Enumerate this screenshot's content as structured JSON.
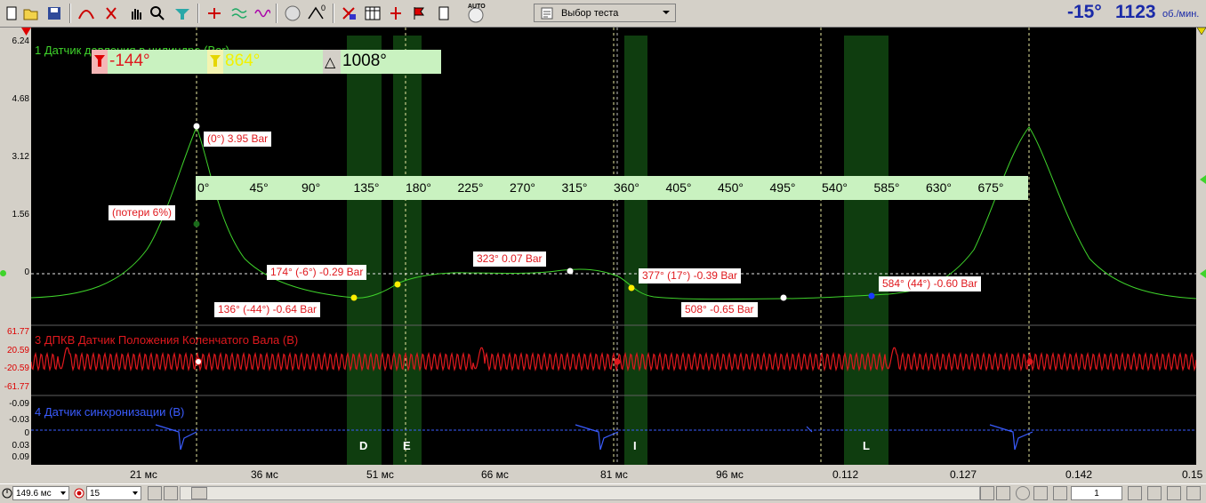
{
  "toolbar": {
    "test_select_label": "Выбор теста",
    "auto_label": "AUTO",
    "counter_small": "0"
  },
  "header": {
    "angle": "-15°",
    "rpm": "1123",
    "rpm_unit": "об./мин."
  },
  "cursor_panel": {
    "cursor1": "-144°",
    "cursor2": "864°",
    "delta_symbol": "△",
    "delta": "1008°"
  },
  "channels": {
    "ch1_title": "1 Датчик давления в цилиндре (Bar)",
    "ch3_title": "3 ДПКВ Датчик Положения Коленчатого Вала (В)",
    "ch4_title": "4 Датчик синхронизации (В)"
  },
  "y_axis": {
    "ch1_ticks": [
      "6.24",
      "4.68",
      "3.12",
      "1.56",
      "0"
    ],
    "ch3_ticks": [
      "61.77",
      "20.59",
      "-20.59",
      "-61.77"
    ],
    "ch4_ticks": [
      "-0.09",
      "-0.03",
      "0",
      "0.03",
      "0.09"
    ]
  },
  "angle_strip": {
    "ticks": [
      "0°",
      "45°",
      "90°",
      "135°",
      "180°",
      "225°",
      "270°",
      "315°",
      "360°",
      "405°",
      "450°",
      "495°",
      "540°",
      "585°",
      "630°",
      "675°"
    ]
  },
  "annotations": {
    "peak": "(0°) 3.95 Bar",
    "losses": "(потери 6%)",
    "a136": "136° (-44°) -0.64 Bar",
    "a174": "174° (-6°) -0.29 Bar",
    "a323": "323° 0.07 Bar",
    "a377": "377° (17°) -0.39 Bar",
    "a508": "508° -0.65 Bar",
    "a584": "584° (44°) -0.60 Bar"
  },
  "zones": {
    "d": "D",
    "e": "E",
    "i": "I",
    "l": "L"
  },
  "x_axis": {
    "ticks": [
      "21 мс",
      "36 мс",
      "51 мс",
      "66 мс",
      "81 мс",
      "96 мс",
      "0.112",
      "0.127",
      "0.142",
      "0.15"
    ]
  },
  "statusbar": {
    "timebase": "149.6 мс",
    "channel_count": "15",
    "page_number": "1"
  },
  "colors": {
    "ch1": "#3fd42b",
    "ch3": "#e0191e",
    "ch4": "#3a5cff",
    "zone": "#0f3d0f",
    "strip": "#c9f2c0"
  }
}
